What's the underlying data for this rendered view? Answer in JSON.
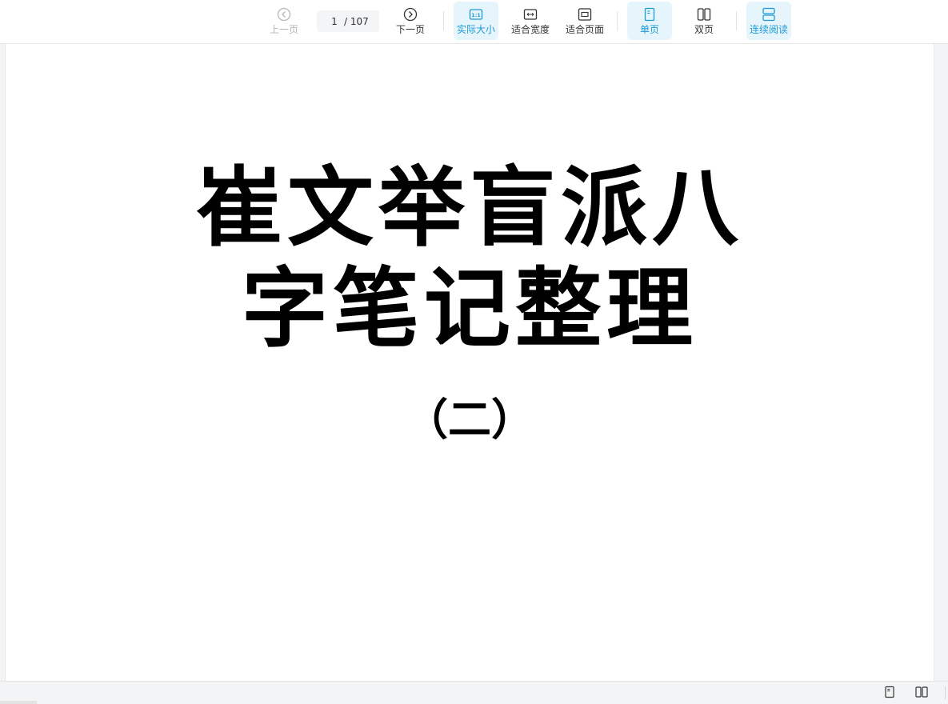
{
  "toolbar": {
    "prev_label": "上一页",
    "page_current": "1",
    "page_total": "/ 107",
    "next_label": "下一页",
    "actual_size_label": "实际大小",
    "actual_size_icon_text": "1:1",
    "fit_width_label": "适合宽度",
    "fit_page_label": "适合页面",
    "single_page_label": "单页",
    "double_page_label": "双页",
    "continuous_label": "连续阅读"
  },
  "document": {
    "title_line1": "崔文举盲派八",
    "title_line2": "字笔记整理",
    "subtitle": "（二）"
  },
  "colors": {
    "accent": "#1e9bd7",
    "active_bg": "#e6f4fb",
    "disabled": "#b5b5b5"
  }
}
